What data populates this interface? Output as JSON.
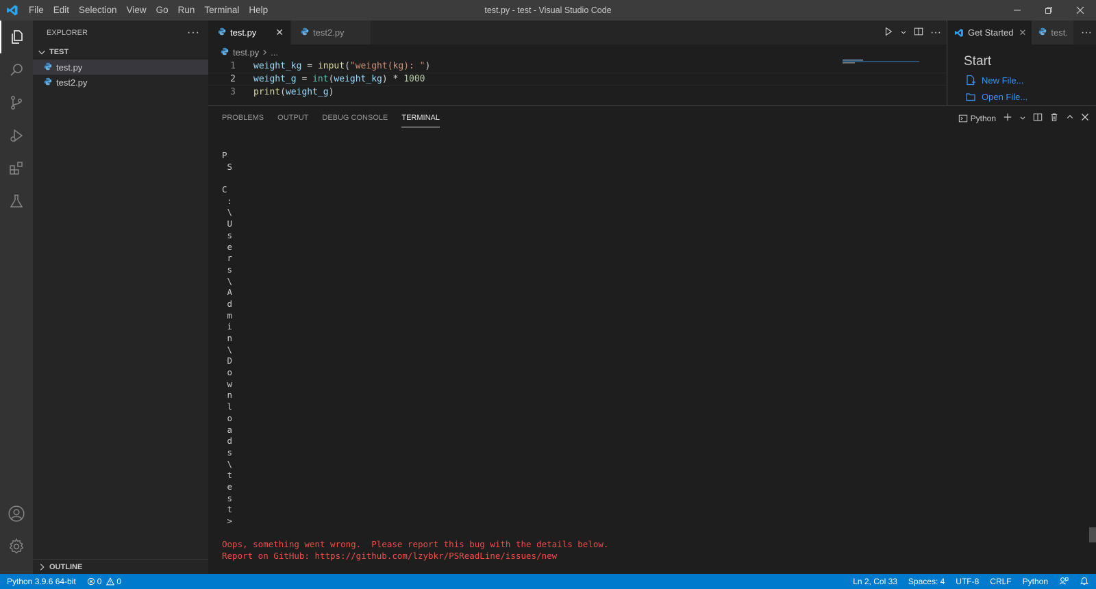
{
  "window": {
    "title": "test.py - test - Visual Studio Code"
  },
  "menu": [
    "File",
    "Edit",
    "Selection",
    "View",
    "Go",
    "Run",
    "Terminal",
    "Help"
  ],
  "sidebar": {
    "header": "EXPLORER",
    "folder": "TEST",
    "files": [
      "test.py",
      "test2.py"
    ],
    "outline": "OUTLINE"
  },
  "editor": {
    "tabs": [
      {
        "label": "test.py",
        "active": true
      },
      {
        "label": "test2.py",
        "active": false
      }
    ],
    "breadcrumb": {
      "file": "test.py",
      "rest": "..."
    },
    "lines": [
      {
        "no": "1"
      },
      {
        "no": "2"
      },
      {
        "no": "3"
      }
    ],
    "code": {
      "l1": {
        "var": "weight_kg",
        "eq": " = ",
        "fn": "input",
        "open": "(",
        "str": "\"weight(kg): \"",
        "close": ")"
      },
      "l2": {
        "var": "weight_g",
        "eq": " = ",
        "type": "int",
        "open": "(",
        "arg": "weight_kg",
        "close": ")",
        "op": " * ",
        "num": "1000"
      },
      "l3": {
        "fn": "print",
        "open": "(",
        "arg": "weight_g",
        "close": ")"
      }
    }
  },
  "right_group": {
    "tabs": [
      "Get Started",
      "test."
    ],
    "start": "Start",
    "links": [
      "New File...",
      "Open File..."
    ]
  },
  "panel": {
    "tabs": [
      "PROBLEMS",
      "OUTPUT",
      "DEBUG CONSOLE",
      "TERMINAL"
    ],
    "active_tab": "TERMINAL",
    "shell": "Python",
    "terminal_chars": [
      "P",
      " S",
      "",
      "C",
      " :",
      " \\",
      " U",
      " s",
      " e",
      " r",
      " s",
      " \\",
      " A",
      " d",
      " m",
      " i",
      " n",
      " \\",
      " D",
      " o",
      " w",
      " n",
      " l",
      " o",
      " a",
      " d",
      " s",
      " \\",
      " t",
      " e",
      " s",
      " t",
      " >"
    ],
    "error_lines": [
      "Oops, something went wrong.  Please report this bug with the details below.",
      "Report on GitHub: https://github.com/lzybkr/PSReadLine/issues/new"
    ]
  },
  "statusbar": {
    "interpreter": "Python 3.9.6 64-bit",
    "errors": "0",
    "warnings": "0",
    "position": "Ln 2, Col 33",
    "spaces": "Spaces: 4",
    "encoding": "UTF-8",
    "eol": "CRLF",
    "language": "Python"
  },
  "colors": {
    "accent": "#007acc",
    "error": "#f14c4c",
    "link": "#3794ff"
  }
}
